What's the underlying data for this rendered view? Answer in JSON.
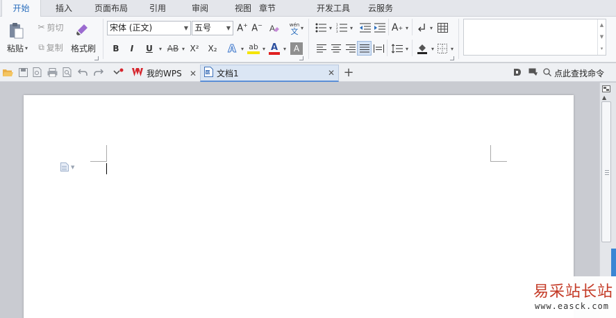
{
  "menu_tabs": [
    {
      "label": "开始",
      "active": true
    },
    {
      "label": "插入"
    },
    {
      "label": "页面布局"
    },
    {
      "label": "引用"
    },
    {
      "label": "审阅"
    },
    {
      "label": "视图"
    },
    {
      "label": "章节"
    },
    {
      "label": "开发工具"
    },
    {
      "label": "云服务"
    }
  ],
  "ribbon": {
    "paste_label": "粘贴",
    "cut_label": "剪切",
    "copy_label": "复制",
    "format_painter_label": "格式刷",
    "font_name": "宋体 (正文)",
    "font_size": "五号",
    "bold": "B",
    "italic": "I",
    "underline": "U",
    "strike": "AB",
    "superscript": "X²",
    "subscript": "X₂",
    "phonetic": "wén",
    "phonetic_char": "文"
  },
  "doc_tabs": [
    {
      "label": "我的WPS",
      "icon": "wps-logo-icon"
    },
    {
      "label": "文档1",
      "icon": "document-icon",
      "active": true
    }
  ],
  "search_command_label": "点此查找命令",
  "watermark": {
    "text": "易采站长站",
    "url": "www.easck.com"
  },
  "colors": {
    "accent": "#2a6ebd",
    "wps_red": "#d6262e",
    "highlight_yellow": "#f5e400",
    "font_color_red": "#e02020"
  }
}
